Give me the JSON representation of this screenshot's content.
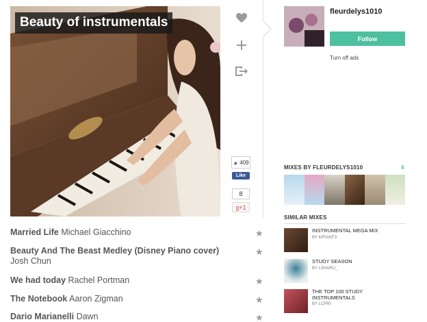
{
  "mix": {
    "title": "Beauty of instrumentals"
  },
  "actions": {
    "like_icon": "heart-icon",
    "add_icon": "plus-icon",
    "share_icon": "share-icon"
  },
  "social": {
    "fb_count": "409",
    "fb_like": "Like",
    "gplus_count": "8",
    "gplus_label": "g+1"
  },
  "user": {
    "name": "fleurdelys1010",
    "follow_label": "Follow",
    "turn_off_ads": "Turn off ads"
  },
  "mixes_by": {
    "heading": "MIXES BY FLEURDELYS1010",
    "count": "4"
  },
  "similar": {
    "heading": "SIMILAR MIXES",
    "items": [
      {
        "title": "INSTRUMENTAL MEGA MIX",
        "by": "by kifiant3"
      },
      {
        "title": "STUDY SEASON",
        "by": "by lsharu_"
      },
      {
        "title": "THE TOP 100 STUDY INSTRUMENTALS",
        "by": "by lcpri"
      }
    ]
  },
  "tracks": [
    {
      "song": "Married Life",
      "artist": "Michael Giacchino"
    },
    {
      "song": "Beauty And The Beast Medley (Disney Piano cover)",
      "artist": "Josh Chun"
    },
    {
      "song": "We had today",
      "artist": "Rachel Portman"
    },
    {
      "song": "The Notebook",
      "artist": "Aaron Zigman"
    },
    {
      "song": "Dario Marianelli",
      "artist": "Dawn"
    }
  ],
  "colors": {
    "accent": "#4ebf9f",
    "facebook": "#3b5998"
  }
}
